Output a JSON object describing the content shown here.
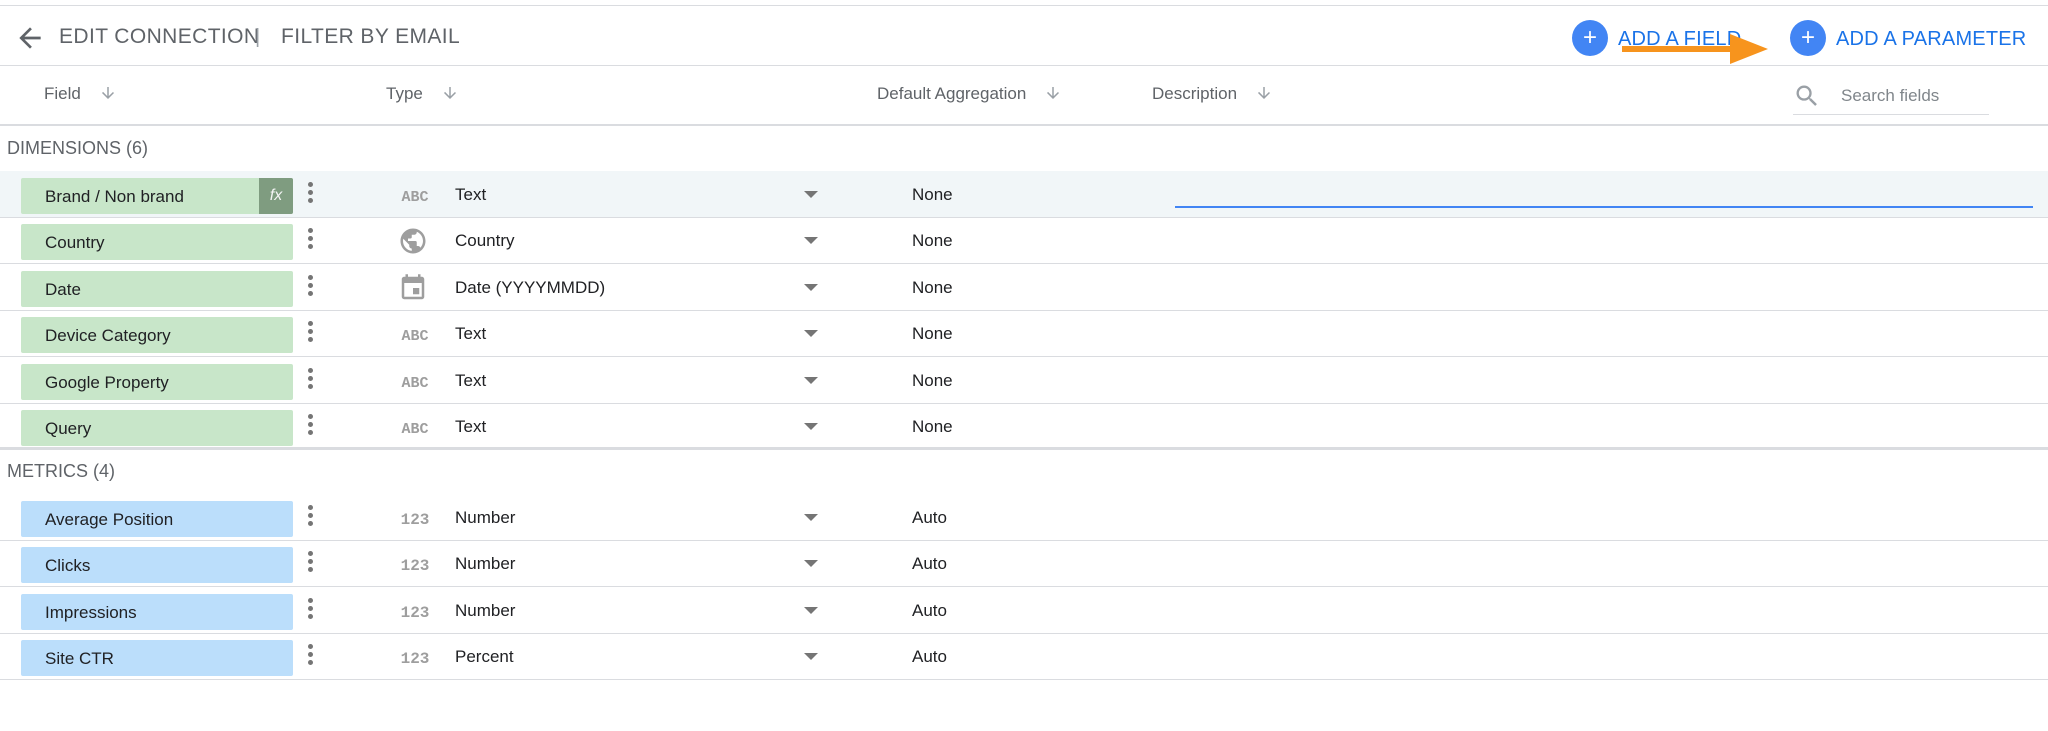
{
  "header": {
    "title": "EDIT CONNECTION",
    "separator": "|",
    "subtitle": "FILTER BY EMAIL",
    "add_field_label": "ADD A FIELD",
    "add_parameter_label": "ADD A PARAMETER",
    "plus_glyph": "+"
  },
  "columns": {
    "field": "Field",
    "type": "Type",
    "aggregation": "Default Aggregation",
    "description": "Description"
  },
  "search": {
    "placeholder": "Search fields",
    "value": ""
  },
  "dimensions": {
    "label": "DIMENSIONS (6)",
    "rows": [
      {
        "name": "Brand / Non brand",
        "type_icon": "abc-icon",
        "type": "Text",
        "aggregation": "None",
        "calculated_badge": "fx"
      },
      {
        "name": "Country",
        "type_icon": "globe-icon",
        "type": "Country",
        "aggregation": "None"
      },
      {
        "name": "Date",
        "type_icon": "calendar-icon",
        "type": "Date (YYYYMMDD)",
        "aggregation": "None"
      },
      {
        "name": "Device Category",
        "type_icon": "abc-icon",
        "type": "Text",
        "aggregation": "None"
      },
      {
        "name": "Google Property",
        "type_icon": "abc-icon",
        "type": "Text",
        "aggregation": "None"
      },
      {
        "name": "Query",
        "type_icon": "abc-icon",
        "type": "Text",
        "aggregation": "None"
      }
    ]
  },
  "metrics": {
    "label": "METRICS (4)",
    "rows": [
      {
        "name": "Average Position",
        "type_icon": "number-icon",
        "type": "Number",
        "aggregation": "Auto"
      },
      {
        "name": "Clicks",
        "type_icon": "number-icon",
        "type": "Number",
        "aggregation": "Auto"
      },
      {
        "name": "Impressions",
        "type_icon": "number-icon",
        "type": "Number",
        "aggregation": "Auto"
      },
      {
        "name": "Site CTR",
        "type_icon": "number-icon",
        "type": "Percent",
        "aggregation": "Auto"
      }
    ]
  },
  "colors": {
    "accent": "#4285f4",
    "link": "#1a73e8",
    "dimension_chip": "#c8e6c9",
    "metric_chip": "#bbdefb",
    "annotation_arrow": "#f7941d"
  }
}
